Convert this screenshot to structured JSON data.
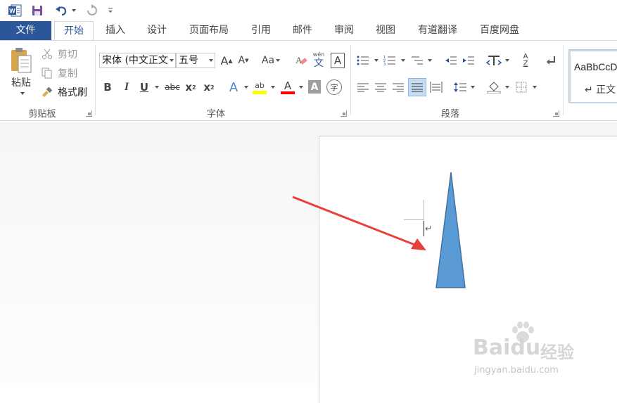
{
  "quick_access": {
    "icons": [
      "word-app-icon",
      "save-icon",
      "undo-icon",
      "redo-icon",
      "customize-icon"
    ]
  },
  "tabs": [
    {
      "label": "文件",
      "type": "file"
    },
    {
      "label": "开始",
      "type": "active"
    },
    {
      "label": "插入"
    },
    {
      "label": "设计"
    },
    {
      "label": "页面布局"
    },
    {
      "label": "引用"
    },
    {
      "label": "邮件"
    },
    {
      "label": "审阅"
    },
    {
      "label": "视图"
    },
    {
      "label": "有道翻译"
    },
    {
      "label": "百度网盘"
    }
  ],
  "clipboard": {
    "paste_label": "粘贴",
    "cut_label": "剪切",
    "copy_label": "复制",
    "format_painter_label": "格式刷",
    "group_label": "剪贴板"
  },
  "font": {
    "font_name": "宋体 (中文正文",
    "font_size": "五号",
    "grow_label": "A",
    "shrink_label": "A",
    "case_label": "Aa",
    "phonetic_top": "wén",
    "phonetic_char": "文",
    "border_char": "A",
    "bold": "B",
    "italic": "I",
    "underline": "U",
    "strike": "abc",
    "sub": "x",
    "sub_mark": "2",
    "sup": "x",
    "sup_mark": "2",
    "effects": "A",
    "highlight": "ab",
    "font_color": "A",
    "shading": "A",
    "enclose": "字",
    "group_label": "字体"
  },
  "paragraph": {
    "group_label": "段落",
    "sort_a": "A",
    "sort_z": "Z"
  },
  "styles": {
    "sample": "AaBbCcDc",
    "name": "↵ 正文"
  },
  "document": {
    "paragraph_mark": "↵"
  },
  "watermark": {
    "brand": "Baidu",
    "brand_cn": "经验",
    "url": "jingyan.baidu.com"
  },
  "colors": {
    "accent": "#2b579a",
    "triangle_fill": "#5b9bd5",
    "triangle_stroke": "#41719c",
    "arrow": "#e8413c",
    "highlight_yellow": "#ffff00",
    "font_red": "#ff0000"
  }
}
